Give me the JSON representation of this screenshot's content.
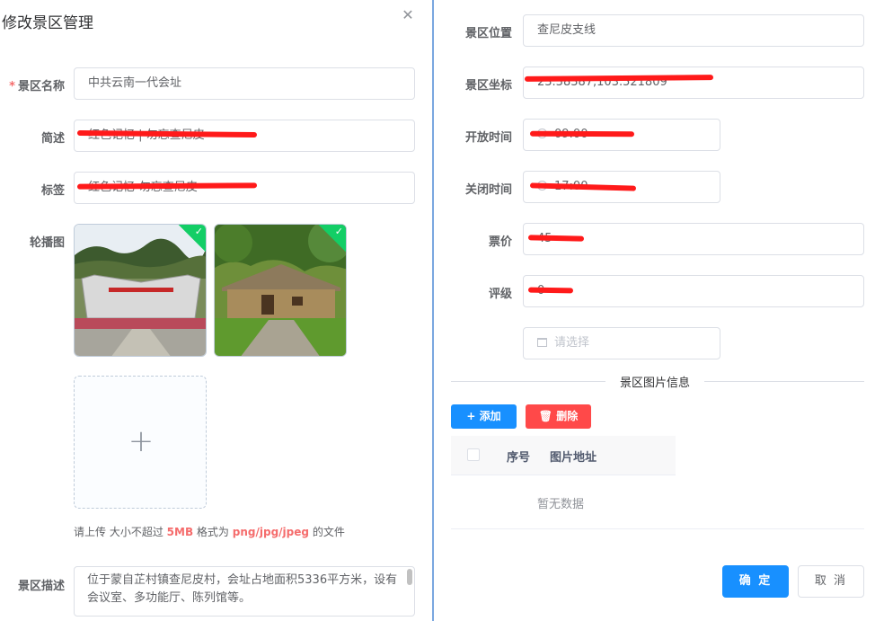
{
  "dialog": {
    "title": "修改景区管理",
    "close_glyph": "✕"
  },
  "form_left": {
    "name": {
      "required_mark": "*",
      "label": "景区名称",
      "value": "中共云南一代会址"
    },
    "brief": {
      "label": "简述",
      "value": "红色记忆 | 勿忘查尼皮"
    },
    "tags": {
      "label": "标签",
      "value": "红色记忆-勿忘查尼皮"
    },
    "carousel": {
      "label": "轮播图",
      "check_glyph": "✓"
    },
    "upload": {
      "plus_glyph": "+",
      "tip_prefix": "请上传 大小不超过",
      "tip_size": "5MB",
      "tip_mid": "格式为",
      "tip_formats": "png/jpg/jpeg",
      "tip_suffix": "的文件"
    },
    "desc": {
      "label": "景区描述",
      "value": "位于蒙自芷村镇查尼皮村，会址占地面积5336平方米，设有会议室、多功能厅、陈列馆等。"
    }
  },
  "form_right": {
    "location": {
      "label": "景区位置",
      "value": "查尼皮支线"
    },
    "coords": {
      "label": "景区坐标",
      "value": "23.38387,103.521809"
    },
    "open_time": {
      "label": "开放时间",
      "value": "09:00"
    },
    "close_time": {
      "label": "关闭时间",
      "value": "17:00"
    },
    "price": {
      "label": "票价",
      "value": "45"
    },
    "rating": {
      "label": "评级",
      "value": "0"
    },
    "select": {
      "placeholder": "请选择"
    }
  },
  "images_section": {
    "title": "景区图片信息",
    "add_label": "添加",
    "add_glyph": "+",
    "delete_label": "删除",
    "delete_glyph": "🗑",
    "columns": [
      "序号",
      "图片地址"
    ],
    "empty_text": "暂无数据"
  },
  "footer": {
    "ok_label": "确 定",
    "cancel_label": "取 消"
  },
  "colors": {
    "primary": "#1890ff",
    "danger": "#ff4949",
    "success_corner": "#13ce66",
    "redaction": "#ff1a1a"
  }
}
